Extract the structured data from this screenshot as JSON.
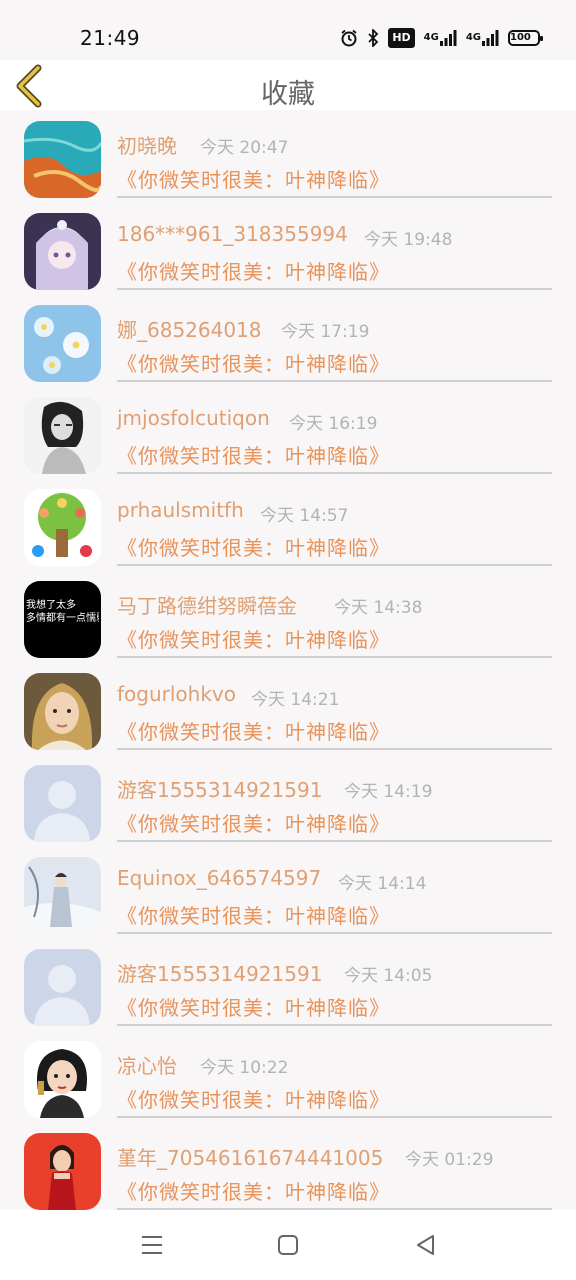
{
  "status_bar": {
    "time": "21:49",
    "hd_label": "HD",
    "network_1": "4G",
    "network_2": "4G",
    "battery": "100",
    "icons": [
      "alarm-icon",
      "bluetooth-icon",
      "hd-icon",
      "signal-icon",
      "signal-icon",
      "battery-icon"
    ]
  },
  "header": {
    "title": "收藏",
    "back_icon": "chevron-left-icon",
    "accent_color": "#e0a073"
  },
  "favorites": [
    {
      "name": "初晓晚",
      "time": "今天 20:47",
      "book": "《你微笑时很美：叶神降临》",
      "avatar": "beach-aerial"
    },
    {
      "name": "186***961_318355994",
      "time": "今天 19:48",
      "book": "《你微笑时很美：叶神降临》",
      "avatar": "anime-girl"
    },
    {
      "name": "娜_685264018",
      "time": "今天 17:19",
      "book": "《你微笑时很美：叶神降临》",
      "avatar": "blue-flowers"
    },
    {
      "name": "jmjosfolcutiqon",
      "time": "今天 16:19",
      "book": "《你微笑时很美：叶神降临》",
      "avatar": "bw-sketch-girl"
    },
    {
      "name": "prhaulsmitfh",
      "time": "今天 14:57",
      "book": "《你微笑时很美：叶神降临》",
      "avatar": "cartoon-tree"
    },
    {
      "name": "马丁路德绀努瞬蓓金",
      "time": "今天 14:38",
      "book": "《你微笑时很美：叶神降临》",
      "avatar": "text-card",
      "avatar_text": [
        "我想了太多",
        "多情都有一点懦弱"
      ]
    },
    {
      "name": "fogurlohkvo",
      "time": "今天 14:21",
      "book": "《你微笑时很美：叶神降临》",
      "avatar": "selfie"
    },
    {
      "name": "游客1555314921591",
      "time": "今天 14:19",
      "book": "《你微笑时很美：叶神降临》",
      "avatar": "default-user"
    },
    {
      "name": "Equinox_646574597",
      "time": "今天 14:14",
      "book": "《你微笑时很美：叶神降临》",
      "avatar": "snow-figure"
    },
    {
      "name": "游客1555314921591",
      "time": "今天 14:05",
      "book": "《你微笑时很美：叶神降临》",
      "avatar": "default-user"
    },
    {
      "name": "凉心怡",
      "time": "今天 10:22",
      "book": "《你微笑时很美：叶神降临》",
      "avatar": "illustrated-girl"
    },
    {
      "name": "堇年_70546161674441005",
      "time": "今天 01:29",
      "book": "《你微笑时很美：叶神降临》",
      "avatar": "red-dress"
    }
  ],
  "nav_bar": {
    "buttons": [
      "menu-icon",
      "home-icon",
      "back-triangle-icon"
    ]
  }
}
